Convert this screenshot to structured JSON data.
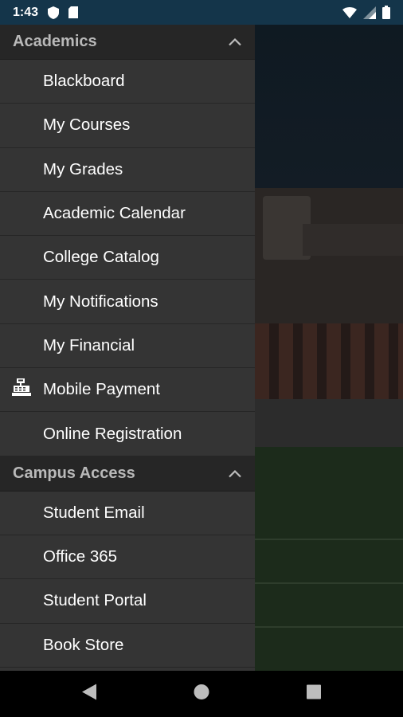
{
  "status_bar": {
    "time": "1:43",
    "icons_left": [
      "shield-icon",
      "sd-card-icon"
    ],
    "icons_right": [
      "wifi-icon",
      "signal-icon",
      "battery-icon"
    ]
  },
  "drawer": {
    "sections": [
      {
        "title": "Academics",
        "expanded": true,
        "items": [
          {
            "label": "Blackboard",
            "icon": null
          },
          {
            "label": "My Courses",
            "icon": null
          },
          {
            "label": "My Grades",
            "icon": null
          },
          {
            "label": "Academic Calendar",
            "icon": null
          },
          {
            "label": "College Catalog",
            "icon": null
          },
          {
            "label": "My Notifications",
            "icon": null
          },
          {
            "label": "My Financial",
            "icon": null
          },
          {
            "label": "Mobile Payment",
            "icon": "cash-register-icon"
          },
          {
            "label": "Online Registration",
            "icon": null
          }
        ]
      },
      {
        "title": "Campus Access",
        "expanded": true,
        "items": [
          {
            "label": "Student Email",
            "icon": null
          },
          {
            "label": "Office 365",
            "icon": null
          },
          {
            "label": "Student Portal",
            "icon": null
          },
          {
            "label": "Book Store",
            "icon": null
          }
        ]
      }
    ]
  },
  "nav_bar": {
    "buttons": [
      "back-icon",
      "home-icon",
      "recents-icon"
    ]
  },
  "colors": {
    "status_bar": "#14354a",
    "drawer_bg": "#343434",
    "section_header_bg": "#262626",
    "section_header_text": "#b9b9b9",
    "item_text": "#ffffff"
  }
}
